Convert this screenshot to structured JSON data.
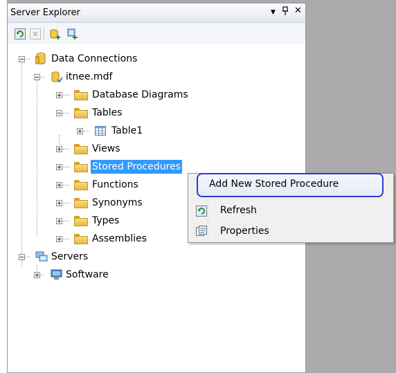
{
  "window": {
    "title": "Server Explorer",
    "controls": {
      "dropdown": "▼",
      "pin": "ᵖ",
      "close": "✕"
    }
  },
  "toolbar": {
    "buttons": [
      {
        "icon": "refresh-icon"
      },
      {
        "icon": "stop-icon"
      },
      {
        "icon": "connect-to-database-icon"
      },
      {
        "icon": "connect-to-server-icon"
      }
    ]
  },
  "tree": {
    "data_connections": "Data Connections",
    "database": "itnee.mdf",
    "database_diagrams": "Database Diagrams",
    "tables": "Tables",
    "table1": "Table1",
    "views": "Views",
    "stored_procedures": "Stored Procedures",
    "functions": "Functions",
    "synonyms": "Synonyms",
    "types": "Types",
    "assemblies": "Assemblies",
    "servers": "Servers",
    "software": "Software"
  },
  "context_menu": {
    "add_new_stored_procedure": "Add New Stored Procedure",
    "refresh": "Refresh",
    "properties": "Properties"
  },
  "colors": {
    "selection": "#3399ff",
    "highlight_border": "#2d3bd1",
    "document_area": "#ababab"
  }
}
